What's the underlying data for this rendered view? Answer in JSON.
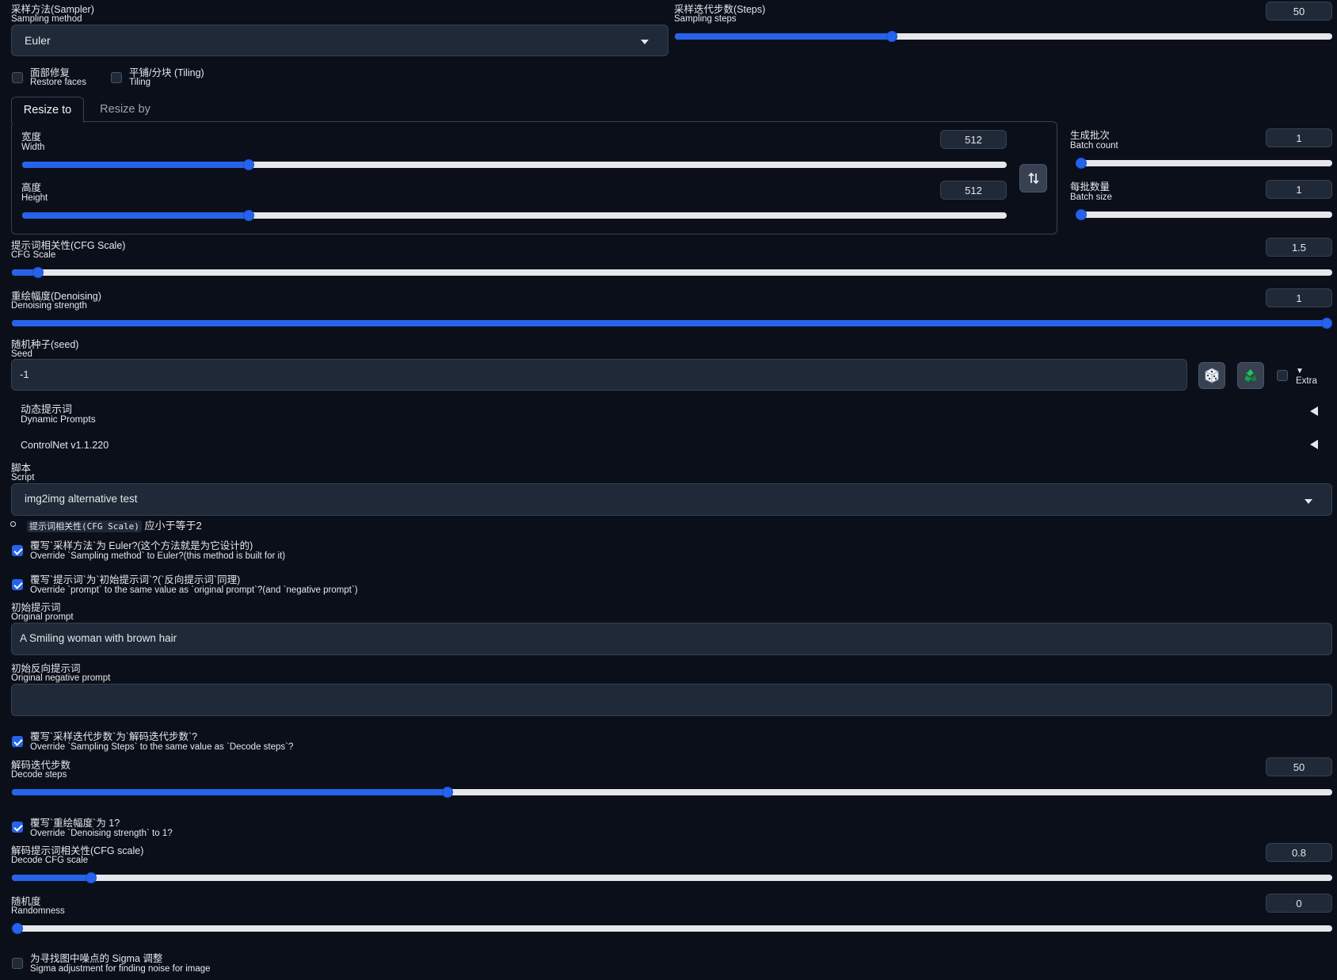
{
  "sampler": {
    "label_cn": "采样方法(Sampler)",
    "label_en": "Sampling method",
    "value": "Euler"
  },
  "steps": {
    "label_cn": "采样迭代步数(Steps)",
    "label_en": "Sampling steps",
    "value": "50",
    "level_percent": 33
  },
  "restore_faces": {
    "label_cn": "面部修复",
    "label_en": "Restore faces",
    "checked": false
  },
  "tiling": {
    "label_cn": "平铺/分块 (Tiling)",
    "label_en": "Tiling",
    "checked": false
  },
  "resize_tabs": [
    "Resize to",
    "Resize by"
  ],
  "width": {
    "label_cn": "宽度",
    "label_en": "Width",
    "value": "512",
    "level_percent": 23
  },
  "height": {
    "label_cn": "高度",
    "label_en": "Height",
    "value": "512",
    "level_percent": 23
  },
  "batch_count": {
    "label_cn": "生成批次",
    "label_en": "Batch count",
    "value": "1",
    "level_percent": 0
  },
  "batch_size": {
    "label_cn": "每批数量",
    "label_en": "Batch size",
    "value": "1",
    "level_percent": 0
  },
  "cfg": {
    "label_cn": "提示词相关性(CFG Scale)",
    "label_en": "CFG Scale",
    "value": "1.5",
    "level_percent": 2
  },
  "denoise": {
    "label_cn": "重绘幅度(Denoising)",
    "label_en": "Denoising strength",
    "value": "1",
    "level_percent": 100
  },
  "seed": {
    "label_cn": "随机种子(seed)",
    "label_en": "Seed",
    "value": "-1",
    "extra_label": "Extra",
    "dice_icon": "dice-icon",
    "recycle_icon": "recycle-icon"
  },
  "accordions": [
    {
      "label_cn": "动态提示词",
      "label_en": "Dynamic Prompts"
    },
    {
      "label": "ControlNet v1.1.220"
    }
  ],
  "script": {
    "label_cn": "脚本",
    "label_en": "Script",
    "value": "img2img alternative test"
  },
  "note": {
    "code": "提示词相关性(CFG Scale)",
    "text": "应小于等于2"
  },
  "override_sampler": {
    "label_cn": "覆写`采样方法`为 Euler?(这个方法就是为它设计的)",
    "label_en": "Override `Sampling method` to Euler?(this method is built for it)",
    "checked": true
  },
  "override_prompt": {
    "label_cn": "覆写`提示词`为`初始提示词`?(`反向提示词`同理)",
    "label_en": "Override `prompt` to the same value as `original prompt`?(and `negative prompt`)",
    "checked": true
  },
  "original_prompt": {
    "label_cn": "初始提示词",
    "label_en": "Original prompt",
    "value": "A Smiling woman with brown hair"
  },
  "original_negative": {
    "label_cn": "初始反向提示词",
    "label_en": "Original negative prompt",
    "value": ""
  },
  "override_steps": {
    "label_cn": "覆写`采样迭代步数`为`解码迭代步数`?",
    "label_en": "Override `Sampling Steps` to the same value as `Decode steps`?",
    "checked": true
  },
  "decode_steps": {
    "label_cn": "解码迭代步数",
    "label_en": "Decode steps",
    "value": "50",
    "level_percent": 33
  },
  "override_denoise": {
    "label_cn": "覆写`重绘幅度`为 1?",
    "label_en": "Override `Denoising strength` to 1?",
    "checked": true
  },
  "decode_cfg": {
    "label_cn": "解码提示词相关性(CFG scale)",
    "label_en": "Decode CFG scale",
    "value": "0.8",
    "level_percent": 6
  },
  "randomness": {
    "label_cn": "随机度",
    "label_en": "Randomness",
    "value": "0",
    "level_percent": 0
  },
  "sigma": {
    "label_cn": "为寻找图中噪点的 Sigma 调整",
    "label_en": "Sigma adjustment for finding noise for image",
    "checked": false
  },
  "colors": {
    "background": "#0b0f19",
    "accent": "#2563eb",
    "field": "#1f2937",
    "border": "#374151"
  }
}
